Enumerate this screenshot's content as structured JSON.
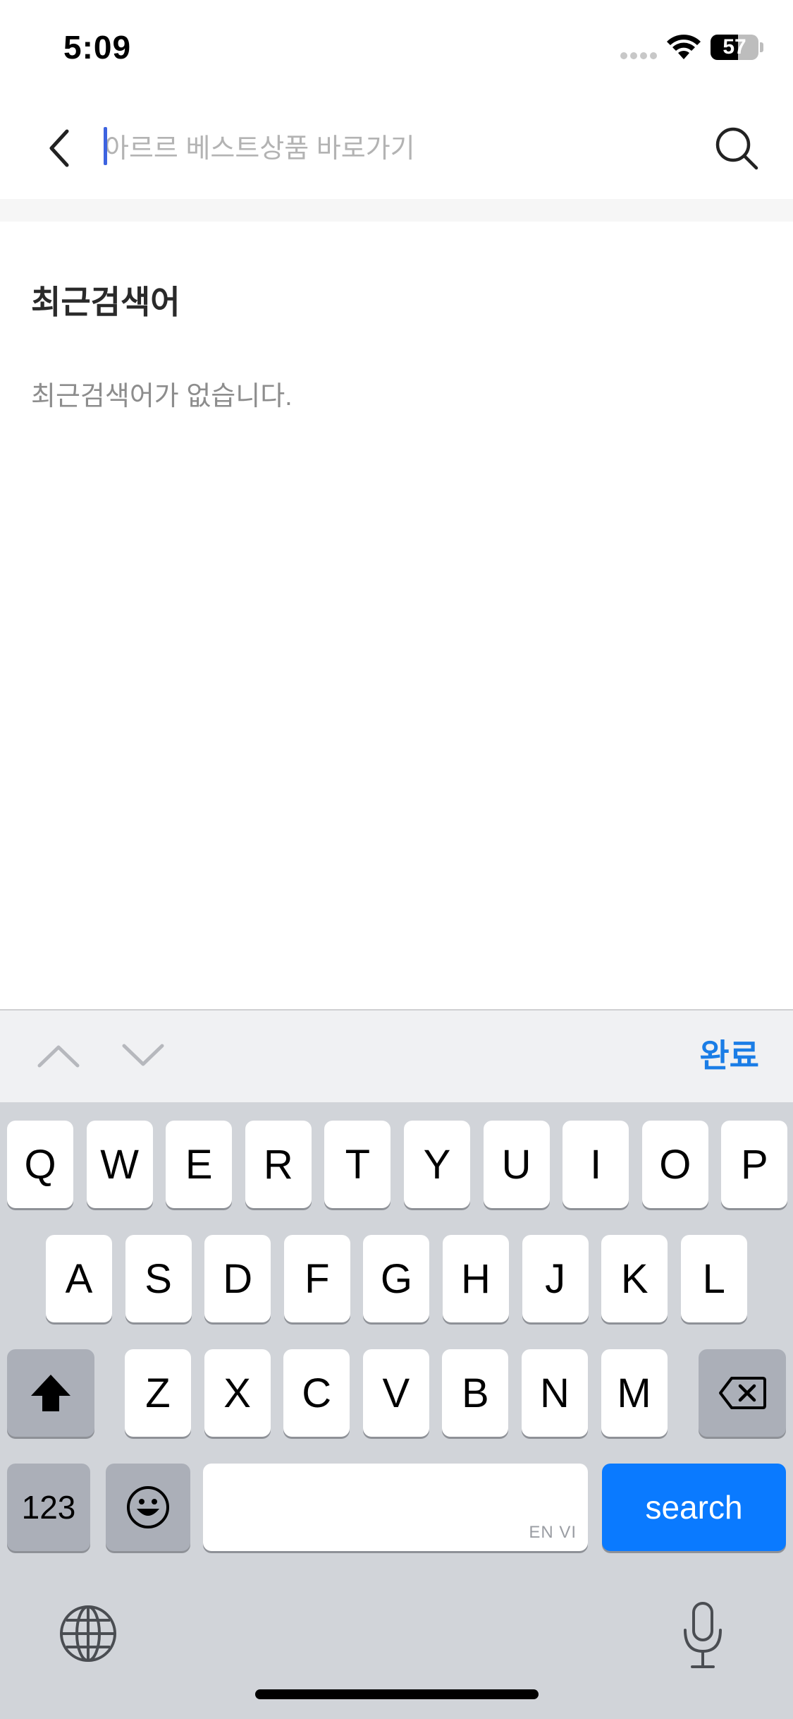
{
  "status_bar": {
    "time": "5:09",
    "battery": "57",
    "battery_level_percent": 57
  },
  "search": {
    "placeholder": "아르르 베스트상품 바로가기",
    "value": "",
    "back_icon": "chevron-left-icon",
    "search_icon": "search-icon"
  },
  "recent": {
    "title": "최근검색어",
    "empty_message": "최근검색어가 없습니다."
  },
  "accessory": {
    "done_label": "완료",
    "up_icon": "chevron-up-icon",
    "down_icon": "chevron-down-icon"
  },
  "keyboard": {
    "row1": [
      "Q",
      "W",
      "E",
      "R",
      "T",
      "Y",
      "U",
      "I",
      "O",
      "P"
    ],
    "row2": [
      "A",
      "S",
      "D",
      "F",
      "G",
      "H",
      "J",
      "K",
      "L"
    ],
    "row3": [
      "Z",
      "X",
      "C",
      "V",
      "B",
      "N",
      "M"
    ],
    "numbers_label": "123",
    "space_languages": "EN VI",
    "return_label": "search",
    "shift_icon": "shift-icon",
    "delete_icon": "delete-icon",
    "emoji_icon": "emoji-icon",
    "globe_icon": "globe-icon",
    "mic_icon": "microphone-icon"
  },
  "colors": {
    "accent_blue": "#0a7aff",
    "done_blue": "#1a7de6",
    "caret": "#3d63e0",
    "keyboard_bg": "#d1d4d9"
  }
}
